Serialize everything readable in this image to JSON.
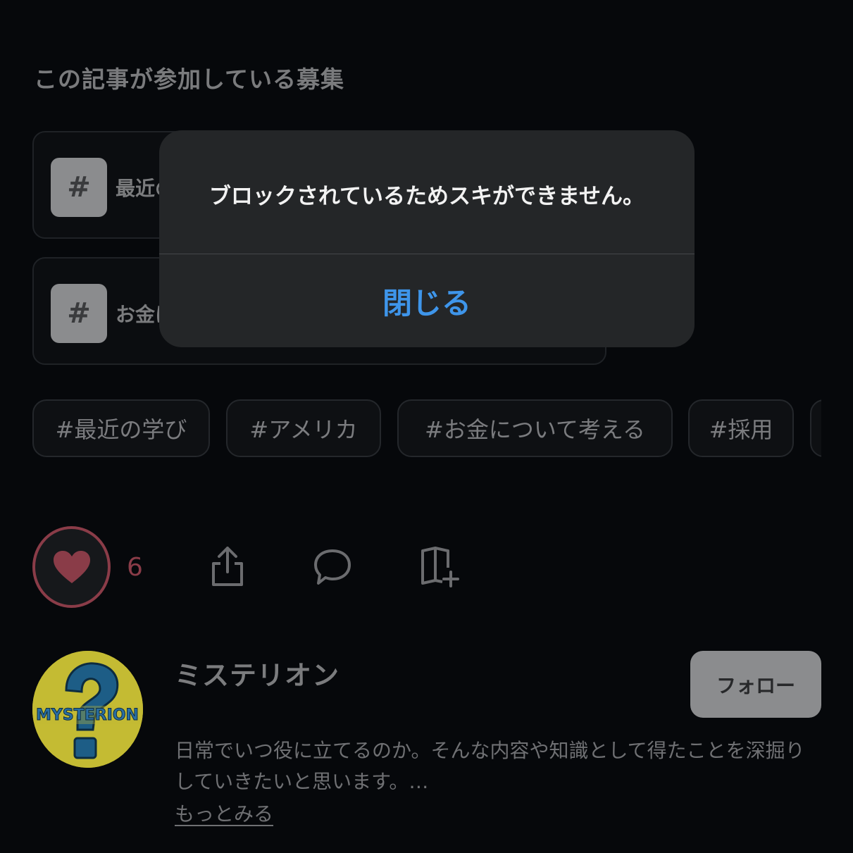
{
  "section": {
    "title": "この記事が参加している募集"
  },
  "contests": [
    {
      "icon": "#",
      "label_visible": "最近の"
    },
    {
      "icon": "#",
      "label_visible": "お金に"
    }
  ],
  "tags": [
    "#最近の学び",
    "#アメリカ",
    "#お金について考える",
    "#採用"
  ],
  "actions": {
    "like_count": "6",
    "icons": [
      "heart-icon",
      "share-icon",
      "comment-icon",
      "magazine-add-icon"
    ]
  },
  "author": {
    "avatar_text": "MYSTERION",
    "name": "ミステリオン",
    "follow_label": "フォロー",
    "bio": "日常でいつ役に立てるのか。そんな内容や知識として得たことを深掘りしていきたいと思います。…",
    "more_label": "もっとみる"
  },
  "dialog": {
    "message": "ブロックされているためスキができません。",
    "close_label": "閉じる"
  },
  "colors": {
    "background": "#06080b",
    "dialog_bg": "#242628",
    "accent_blue": "#3e95ea",
    "like_red": "#8a3c48"
  }
}
